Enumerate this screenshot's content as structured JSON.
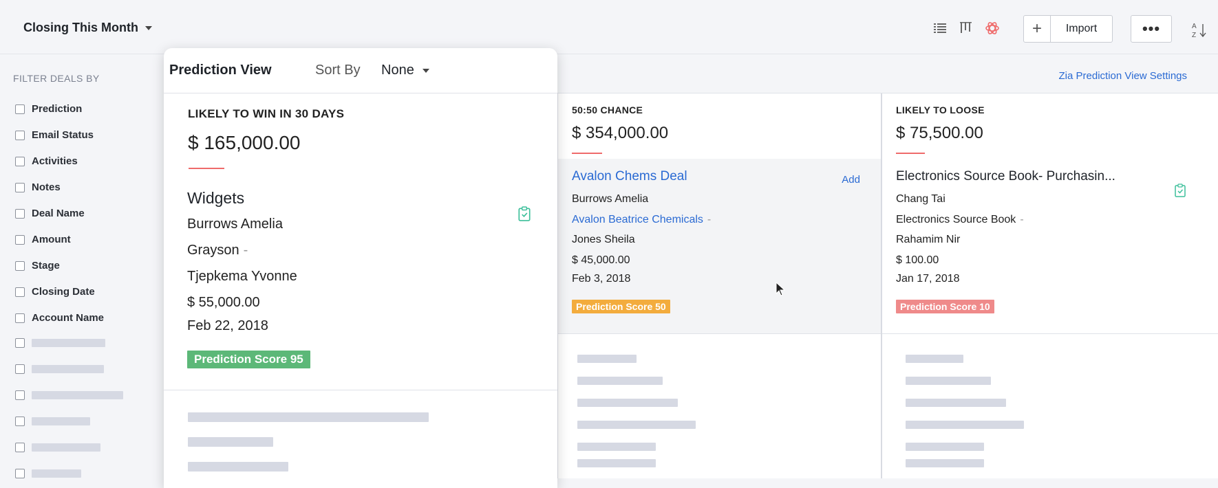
{
  "header": {
    "view_selector": "Closing This Month",
    "icons": [
      "list-view-icon",
      "kanban-view-icon",
      "zia-prediction-icon"
    ],
    "import_label": "Import",
    "more_label": "•••",
    "colors": {
      "accent": "#2a6ad3",
      "zia": "#ef6a6a"
    }
  },
  "sidebar": {
    "title": "FILTER DEALS BY",
    "filters": [
      "Prediction",
      "Email Status",
      "Activities",
      "Notes",
      "Deal Name",
      "Amount",
      "Stage",
      "Closing Date",
      "Account Name"
    ]
  },
  "settings_link": "Zia Prediction View Settings",
  "prediction_panel": {
    "title": "Prediction View",
    "sort_by_label": "Sort By",
    "sort_by_value": "None",
    "column_label": "LIKELY TO WIN IN 30 DAYS",
    "column_total": "$ 165,000.00",
    "card": {
      "title": "Widgets",
      "contact": "Burrows Amelia",
      "account": "Grayson",
      "account_sep": "-",
      "owner": "Tjepkema Yvonne",
      "amount": "$ 55,000.00",
      "date": "Feb 22, 2018",
      "score": "Prediction Score 95",
      "score_color": "#5cb878"
    }
  },
  "columns": [
    {
      "label": "50:50 CHANCE",
      "total": "$ 354,000.00",
      "card": {
        "title": "Avalon Chems Deal",
        "contact": "Burrows Amelia",
        "account": "Avalon Beatrice Chemicals",
        "account_sep": "-",
        "owner": "Jones Sheila",
        "amount": "$ 45,000.00",
        "date": "Feb 3, 2018",
        "score": "Prediction Score 50",
        "score_color": "#f3ac3d",
        "add_label": "Add"
      }
    },
    {
      "label": "LIKELY TO LOOSE",
      "total": "$ 75,500.00",
      "card": {
        "title": "Electronics Source Book- Purchasin...",
        "contact": "Chang Tai",
        "account": "Electronics Source Book",
        "account_sep": "-",
        "owner": "Rahamim Nir",
        "amount": "$ 100.00",
        "date": "Jan 17, 2018",
        "score": "Prediction Score 10",
        "score_color": "#ef8a8a"
      }
    }
  ]
}
